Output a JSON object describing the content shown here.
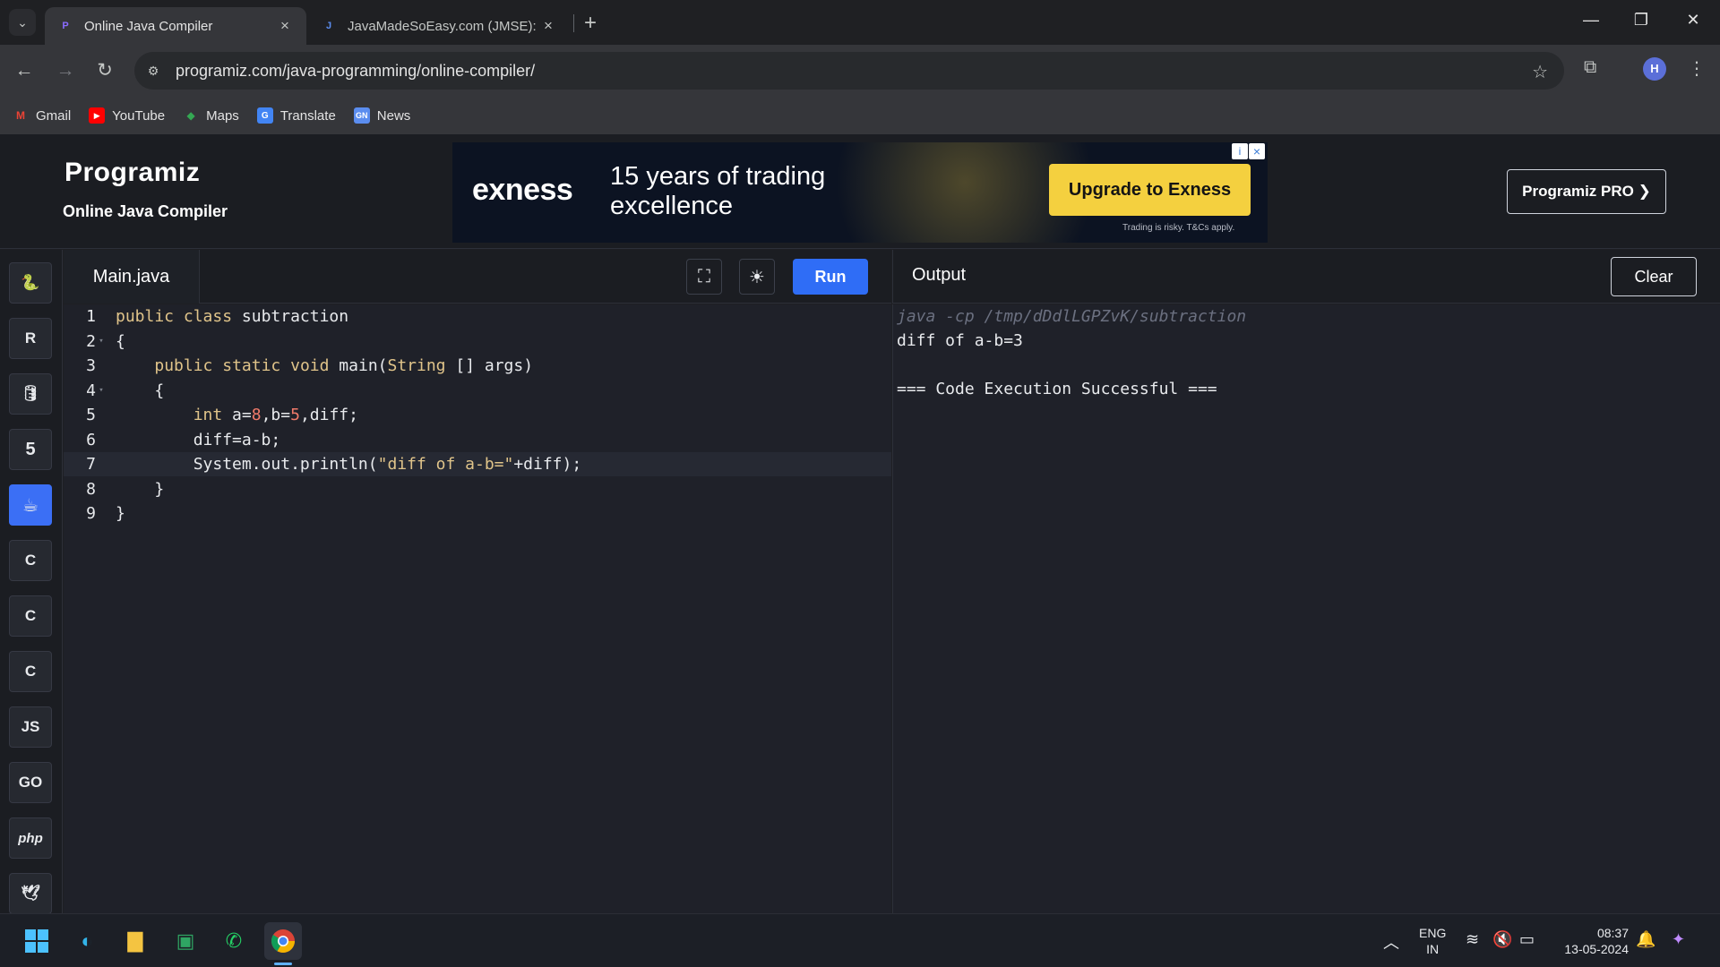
{
  "browser": {
    "tabs": [
      {
        "title": "Online Java Compiler",
        "active": true
      },
      {
        "title": "JavaMadeSoEasy.com (JMSE): W",
        "active": false
      }
    ],
    "url": "programiz.com/java-programming/online-compiler/",
    "profile_initial": "H",
    "bookmarks": [
      {
        "label": "Gmail",
        "icon": "gmail-icon",
        "color": "#ea4335"
      },
      {
        "label": "YouTube",
        "icon": "youtube-icon",
        "color": "#ff0000"
      },
      {
        "label": "Maps",
        "icon": "maps-icon",
        "color": "#34a853"
      },
      {
        "label": "Translate",
        "icon": "translate-icon",
        "color": "#4285f4"
      },
      {
        "label": "News",
        "icon": "news-icon",
        "color": "#5b8def"
      }
    ]
  },
  "site": {
    "logo": "Programiz",
    "subtitle": "Online Java Compiler",
    "pro_button": "Programiz PRO ❯",
    "ad": {
      "brand": "exness",
      "headline": "15 years of trading excellence",
      "cta": "Upgrade to Exness",
      "fine_print": "Trading is risky. T&Cs apply."
    }
  },
  "languages": [
    {
      "name": "python",
      "glyph": "🐍",
      "active": false
    },
    {
      "name": "r",
      "glyph": "R",
      "active": false
    },
    {
      "name": "sql",
      "glyph": "🛢",
      "active": false
    },
    {
      "name": "html",
      "glyph": "5",
      "active": false
    },
    {
      "name": "java",
      "glyph": "☕",
      "active": true
    },
    {
      "name": "c",
      "glyph": "C",
      "active": false
    },
    {
      "name": "cpp",
      "glyph": "C",
      "active": false
    },
    {
      "name": "csharp",
      "glyph": "C",
      "active": false
    },
    {
      "name": "javascript",
      "glyph": "JS",
      "active": false
    },
    {
      "name": "go",
      "glyph": "GO",
      "active": false
    },
    {
      "name": "php",
      "glyph": "php",
      "active": false
    },
    {
      "name": "swift",
      "glyph": "🕊",
      "active": false
    }
  ],
  "editor": {
    "file_name": "Main.java",
    "run_label": "Run",
    "current_line": 7,
    "lines": [
      {
        "n": "1",
        "html": "<span class=\"kw\">public</span> <span class=\"kw\">class</span> subtraction"
      },
      {
        "n": "2",
        "html": "{",
        "fold": true
      },
      {
        "n": "3",
        "html": "    <span class=\"kw\">public</span> <span class=\"kw\">static</span> <span class=\"kw\">void</span> main(<span class=\"kw\">String</span> [] args)"
      },
      {
        "n": "4",
        "html": "    {",
        "fold": true
      },
      {
        "n": "5",
        "html": "        <span class=\"kw\">int</span> a=<span class=\"num\">8</span>,b=<span class=\"num\">5</span>,diff;"
      },
      {
        "n": "6",
        "html": "        diff=a-b;"
      },
      {
        "n": "7",
        "html": "        System.out.println(<span class=\"str\">\"diff of a-b=\"</span>+diff);"
      },
      {
        "n": "8",
        "html": "    }"
      },
      {
        "n": "9",
        "html": "}"
      }
    ]
  },
  "output": {
    "title": "Output",
    "clear_label": "Clear",
    "command": "java -cp /tmp/dDdlLGPZvK/subtraction",
    "lines": [
      "diff of a-b=3",
      "",
      "=== Code Execution Successful ==="
    ]
  },
  "taskbar": {
    "lang_top": "ENG",
    "lang_bottom": "IN",
    "time": "08:37",
    "date": "13-05-2024"
  }
}
